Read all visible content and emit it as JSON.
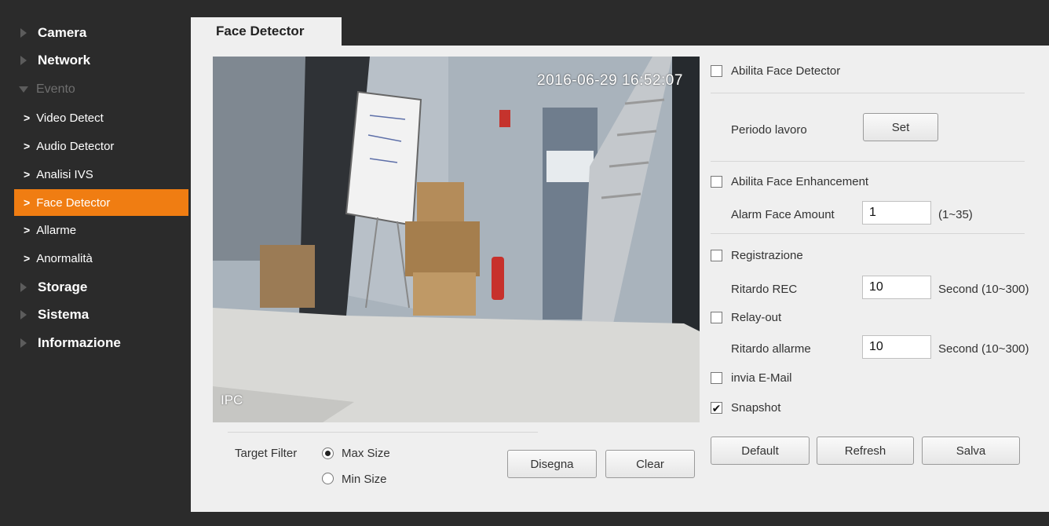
{
  "sidebar": {
    "items": [
      {
        "label": "Camera"
      },
      {
        "label": "Network"
      },
      {
        "label": "Evento"
      },
      {
        "label": "Video Detect"
      },
      {
        "label": "Audio Detector"
      },
      {
        "label": "Analisi IVS"
      },
      {
        "label": "Face Detector"
      },
      {
        "label": "Allarme"
      },
      {
        "label": "Anormalità"
      },
      {
        "label": "Storage"
      },
      {
        "label": "Sistema"
      },
      {
        "label": "Informazione"
      }
    ]
  },
  "tab": {
    "label": "Face Detector"
  },
  "video": {
    "timestamp": "2016-06-29 16:52:07",
    "channel_label": "IPC"
  },
  "target_filter": {
    "label": "Target Filter",
    "options": [
      "Max Size",
      "Min Size"
    ],
    "selected": "Max Size"
  },
  "buttons": {
    "draw": "Disegna",
    "clear": "Clear",
    "set": "Set",
    "default": "Default",
    "refresh": "Refresh",
    "save": "Salva"
  },
  "settings": {
    "enable_face_detector": {
      "label": "Abilita Face Detector",
      "checked": false
    },
    "work_period": {
      "label": "Periodo lavoro"
    },
    "enable_face_enhancement": {
      "label": "Abilita Face Enhancement",
      "checked": false
    },
    "alarm_face_amount": {
      "label": "Alarm Face Amount",
      "value": "1",
      "range": "(1~35)"
    },
    "recording": {
      "label": "Registrazione",
      "checked": false
    },
    "rec_delay": {
      "label": "Ritardo REC",
      "value": "10",
      "unit": "Second (10~300)"
    },
    "relay_out": {
      "label": "Relay-out",
      "checked": false
    },
    "alarm_delay": {
      "label": "Ritardo allarme",
      "value": "10",
      "unit": "Second (10~300)"
    },
    "send_email": {
      "label": "invia E-Mail",
      "checked": false
    },
    "snapshot": {
      "label": "Snapshot",
      "checked": true,
      "mark": "✔"
    }
  },
  "colors": {
    "sidebar_bg": "#2b2b2b",
    "active_item": "#f07d12",
    "panel_bg": "#efefef"
  }
}
